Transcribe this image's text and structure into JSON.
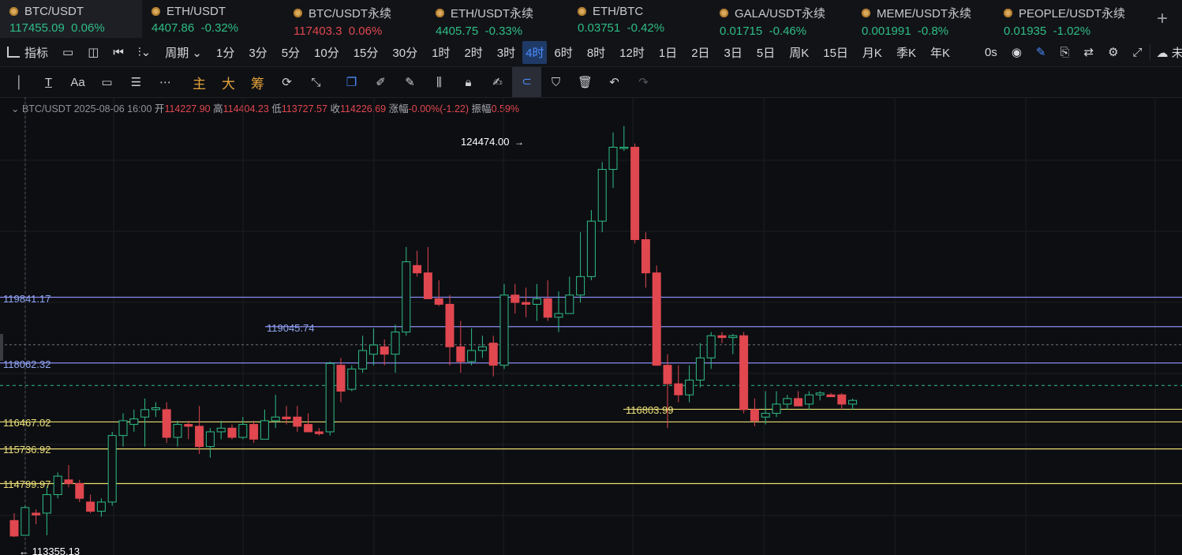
{
  "tabs": [
    {
      "name": "BTC/USDT",
      "price": "117455.09",
      "change": "0.06%",
      "dir": "up",
      "active": true
    },
    {
      "name": "ETH/USDT",
      "price": "4407.86",
      "change": "-0.32%",
      "dir": "up"
    },
    {
      "name": "BTC/USDT永续",
      "price": "117403.3",
      "change": "0.06%",
      "dir": "dn"
    },
    {
      "name": "ETH/USDT永续",
      "price": "4405.75",
      "change": "-0.33%",
      "dir": "up"
    },
    {
      "name": "ETH/BTC",
      "price": "0.03751",
      "change": "-0.42%",
      "dir": "up"
    },
    {
      "name": "GALA/USDT永续",
      "price": "0.01715",
      "change": "-0.46%",
      "dir": "up"
    },
    {
      "name": "MEME/USDT永续",
      "price": "0.001991",
      "change": "-0.8%",
      "dir": "up"
    },
    {
      "name": "PEOPLE/USDT永续",
      "price": "0.01935",
      "change": "-1.02%",
      "dir": "up"
    }
  ],
  "toolbar": {
    "indicator": "指标",
    "period": "周期",
    "intervals": [
      "1分",
      "3分",
      "5分",
      "10分",
      "15分",
      "30分",
      "1时",
      "2时",
      "3时",
      "4时",
      "6时",
      "8时",
      "12时",
      "1日",
      "2日",
      "3日",
      "5日",
      "周K",
      "15日",
      "月K",
      "季K",
      "年K"
    ],
    "selected_interval": "4时",
    "countdown": "0s",
    "cloud": "未命名"
  },
  "drawbar": {
    "main": "主",
    "big": "大",
    "chip": "筹"
  },
  "info": {
    "symbol": "BTC/USDT",
    "time": "2025-08-06 16:00",
    "open_l": "开",
    "open": "114227.90",
    "high_l": "高",
    "high": "114404.23",
    "low_l": "低",
    "low": "113727.57",
    "close_l": "收",
    "close": "114226.69",
    "chg_l": "涨幅",
    "chg": "-0.00%(-1.22)",
    "amp_l": "振幅",
    "amp": "0.59%"
  },
  "chart_data": {
    "type": "candlestick",
    "colors": {
      "up": "#2ebd85",
      "down": "#e0474f",
      "blue_line": "#8a8df0",
      "yellow_line": "#e8dc70"
    },
    "annotations": {
      "high_marker": "124474.00",
      "low_marker": "113355.13",
      "last_low": "116803.99"
    },
    "hlines": [
      {
        "value": 119841.17,
        "label": "119841.17",
        "color": "blue"
      },
      {
        "value": 119045.74,
        "label": "119045.74",
        "color": "blue"
      },
      {
        "value": 118062.32,
        "label": "118062.32",
        "color": "blue"
      },
      {
        "value": 116467.02,
        "label": "116467.02",
        "color": "yellow"
      },
      {
        "value": 115736.92,
        "label": "115736.92",
        "color": "yellow"
      },
      {
        "value": 114799.97,
        "label": "114799.97",
        "color": "yellow"
      }
    ],
    "candles": [
      [
        113800,
        114000,
        113350,
        113380
      ],
      [
        113400,
        114200,
        113400,
        114150
      ],
      [
        114000,
        114100,
        113700,
        113950
      ],
      [
        114000,
        114700,
        113400,
        114500
      ],
      [
        114500,
        115100,
        114400,
        115000
      ],
      [
        114900,
        115300,
        114700,
        114800
      ],
      [
        114800,
        114900,
        114300,
        114400
      ],
      [
        114300,
        114500,
        114000,
        114050
      ],
      [
        114050,
        114400,
        113900,
        114300
      ],
      [
        114300,
        116200,
        114200,
        116100
      ],
      [
        116100,
        116700,
        115800,
        116500
      ],
      [
        116400,
        116800,
        116200,
        116550
      ],
      [
        116600,
        117100,
        115800,
        116800
      ],
      [
        116800,
        117000,
        116600,
        116850
      ],
      [
        116800,
        117000,
        115900,
        116050
      ],
      [
        116050,
        116500,
        115800,
        116400
      ],
      [
        116400,
        116500,
        116000,
        116350
      ],
      [
        116350,
        116900,
        115600,
        115800
      ],
      [
        115800,
        116300,
        115500,
        116200
      ],
      [
        116200,
        116500,
        116000,
        116300
      ],
      [
        116300,
        116400,
        116000,
        116050
      ],
      [
        116050,
        116600,
        116000,
        116400
      ],
      [
        116400,
        116500,
        115900,
        116000
      ],
      [
        116000,
        116800,
        116000,
        116500
      ],
      [
        116500,
        117200,
        116300,
        116600
      ],
      [
        116600,
        116900,
        116400,
        116550
      ],
      [
        116600,
        116900,
        116200,
        116350
      ],
      [
        116400,
        116700,
        116200,
        116200
      ],
      [
        116200,
        116300,
        116100,
        116150
      ],
      [
        116200,
        118100,
        116100,
        118050
      ],
      [
        118000,
        118200,
        117000,
        117300
      ],
      [
        117350,
        118000,
        117300,
        117900
      ],
      [
        117900,
        118800,
        117800,
        118400
      ],
      [
        118300,
        119000,
        118000,
        118550
      ],
      [
        118500,
        118700,
        118000,
        118300
      ],
      [
        118300,
        119100,
        117800,
        118900
      ],
      [
        118900,
        121200,
        118800,
        120800
      ],
      [
        120700,
        121100,
        120400,
        120500
      ],
      [
        120500,
        121200,
        119800,
        119800
      ],
      [
        119800,
        120300,
        119600,
        119650
      ],
      [
        119650,
        119900,
        118000,
        118500
      ],
      [
        118500,
        119200,
        117800,
        118100
      ],
      [
        118100,
        119000,
        118000,
        118400
      ],
      [
        118400,
        118800,
        118200,
        118500
      ],
      [
        118600,
        118800,
        117700,
        118000
      ],
      [
        118000,
        120200,
        117900,
        119900
      ],
      [
        119900,
        120200,
        119400,
        119700
      ],
      [
        119700,
        120100,
        119300,
        119650
      ],
      [
        119650,
        120200,
        119200,
        119800
      ],
      [
        119800,
        120300,
        119200,
        119300
      ],
      [
        119300,
        120000,
        118900,
        119400
      ],
      [
        119400,
        120400,
        119400,
        119900
      ],
      [
        119900,
        121600,
        119700,
        120400
      ],
      [
        120400,
        122200,
        120300,
        121900
      ],
      [
        121900,
        123500,
        121600,
        123300
      ],
      [
        123300,
        124300,
        122800,
        123900
      ],
      [
        123900,
        124474,
        123800,
        123900
      ],
      [
        123900,
        124000,
        121300,
        121400
      ],
      [
        121400,
        121600,
        120100,
        120500
      ],
      [
        120500,
        120700,
        118000,
        118000
      ],
      [
        118000,
        118300,
        116300,
        117500
      ],
      [
        117500,
        118000,
        117000,
        117200
      ],
      [
        117200,
        118000,
        117000,
        117600
      ],
      [
        117600,
        118600,
        117400,
        118200
      ],
      [
        118200,
        118900,
        117900,
        118800
      ],
      [
        118800,
        118900,
        118600,
        118750
      ],
      [
        118750,
        118850,
        118300,
        118800
      ],
      [
        118800,
        118900,
        116700,
        116800
      ],
      [
        116800,
        117100,
        116350,
        116500
      ],
      [
        116600,
        117300,
        116400,
        116700
      ],
      [
        116700,
        117300,
        116600,
        116950
      ],
      [
        116950,
        117200,
        116800,
        117100
      ],
      [
        117100,
        117300,
        116900,
        116900
      ],
      [
        116950,
        117300,
        116800,
        117200
      ],
      [
        117200,
        117300,
        117050,
        117250
      ],
      [
        117200,
        117250,
        117150,
        117150
      ],
      [
        117200,
        117250,
        116800,
        116950
      ],
      [
        116950,
        117100,
        116800,
        117050
      ]
    ]
  }
}
